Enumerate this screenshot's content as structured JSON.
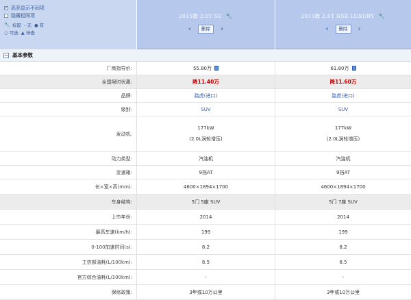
{
  "options": [
    {
      "label": "高亮显示不同项",
      "checked": true
    },
    {
      "label": "隐藏相同项",
      "checked": false
    }
  ],
  "legend": {
    "line1": [
      "标配",
      "- 无",
      "● 有"
    ],
    "line2": [
      "○ 可选",
      "▲ 待查"
    ]
  },
  "cars": [
    {
      "title": "2015款 2.0T SE",
      "delete_label": "删除"
    },
    {
      "title": "2015款 2.0T HSE LUXURY",
      "delete_label": "删除"
    }
  ],
  "section": {
    "title": "基本参数"
  },
  "rows": [
    {
      "label": "厂商指导价:",
      "a": "55.80万",
      "b": "61.80万",
      "type": "price"
    },
    {
      "label": "全国限时优惠:",
      "a": "降11.40万",
      "b": "降11.60万",
      "type": "red"
    },
    {
      "label": "品牌:",
      "a": "路虎(进口)",
      "b": "路虎(进口)",
      "type": "blue"
    },
    {
      "label": "级别:",
      "a": "SUV",
      "b": "SUV",
      "type": "blue"
    },
    {
      "label": "发动机:",
      "a": "177kW",
      "a2": "(2.0L涡轮增压)",
      "b": "177kW",
      "b2": "(2.0L涡轮增压)",
      "type": "double"
    },
    {
      "label": "动力类型:",
      "a": "汽油机",
      "b": "汽油机",
      "type": "plain"
    },
    {
      "label": "变速箱:",
      "a": "9挡AT",
      "b": "9挡AT",
      "type": "plain"
    },
    {
      "label": "长×宽×高(mm):",
      "a": "4600×1894×1700",
      "b": "4600×1894×1700",
      "type": "plain"
    },
    {
      "label": "车身结构:",
      "a": "5门 5座 SUV",
      "b": "5门 7座 SUV",
      "type": "plain"
    },
    {
      "label": "上市年份:",
      "a": "2014",
      "b": "2014",
      "type": "plain"
    },
    {
      "label": "最高车速(km/h):",
      "a": "199",
      "b": "199",
      "type": "plain"
    },
    {
      "label": "0-100加速时间(s):",
      "a": "8.2",
      "b": "8.2",
      "type": "plain"
    },
    {
      "label": "工信部油耗(L/100km):",
      "a": "8.5",
      "b": "8.5",
      "type": "plain"
    },
    {
      "label": "官方综合油耗(L/100km):",
      "a": "-",
      "b": "-",
      "type": "plain"
    },
    {
      "label": "保修政策:",
      "a": "3年或10万公里",
      "b": "3年或10万公里",
      "type": "plain"
    }
  ]
}
